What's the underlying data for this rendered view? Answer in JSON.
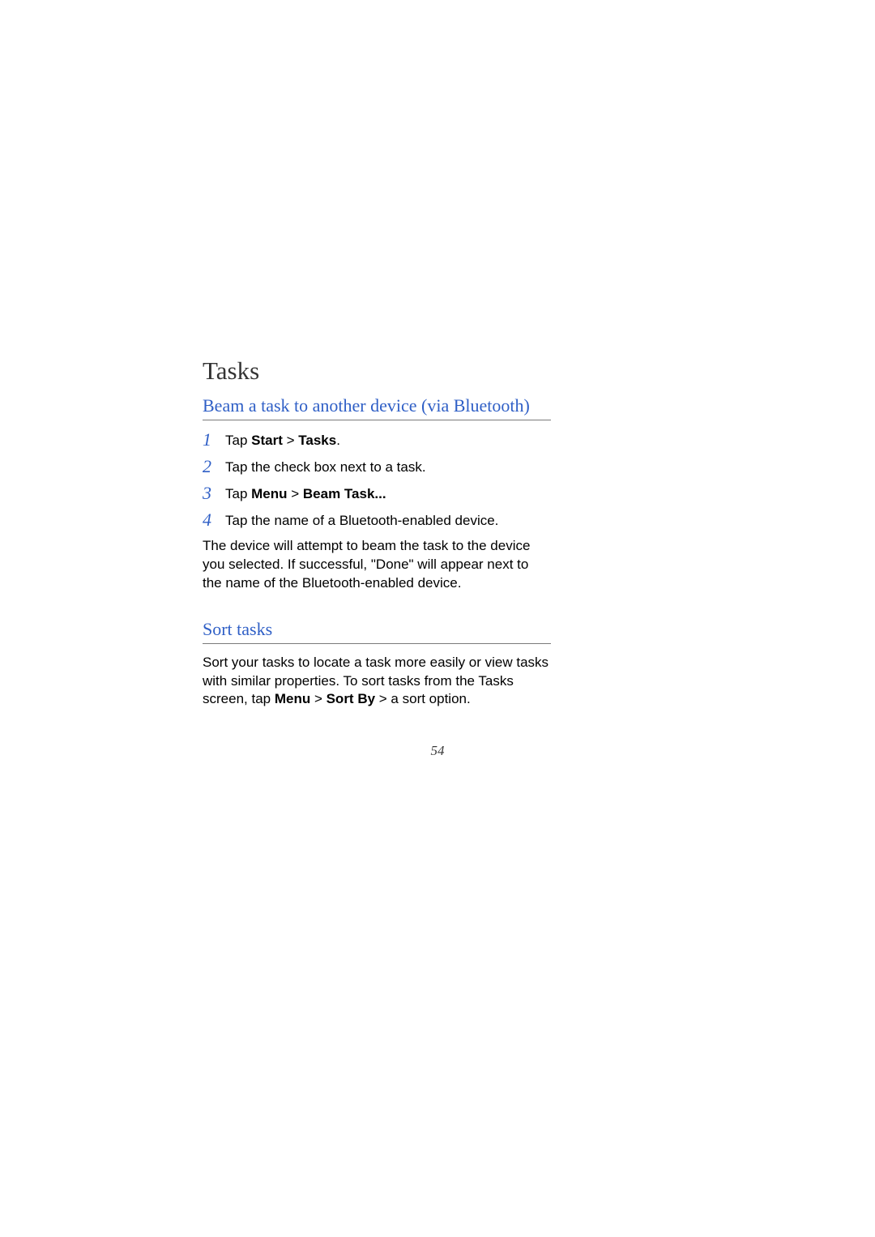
{
  "heading": "Tasks",
  "section1": {
    "title": "Beam a task to another device (via Bluetooth)",
    "steps": [
      {
        "num": "1",
        "pre": "Tap ",
        "bold1": "Start",
        "mid": " > ",
        "bold2": "Tasks",
        "post": "."
      },
      {
        "num": "2",
        "pre": "Tap the check box next to a task.",
        "bold1": "",
        "mid": "",
        "bold2": "",
        "post": ""
      },
      {
        "num": "3",
        "pre": "Tap ",
        "bold1": "Menu",
        "mid": " > ",
        "bold2": "Beam Task...",
        "post": ""
      },
      {
        "num": "4",
        "pre": "Tap the name of a Bluetooth-enabled device.",
        "bold1": "",
        "mid": "",
        "bold2": "",
        "post": ""
      }
    ],
    "body": "The device will attempt to beam the task to the device you selected. If successful, \"Done\" will appear next to the name of the Bluetooth-enabled device."
  },
  "section2": {
    "title": "Sort tasks",
    "body_pre": "Sort your tasks to locate a task more easily or view tasks with similar properties. To sort tasks from the Tasks screen, tap ",
    "body_bold1": "Menu",
    "body_mid": " > ",
    "body_bold2": "Sort By",
    "body_post": " > a sort option."
  },
  "page_number": "54"
}
